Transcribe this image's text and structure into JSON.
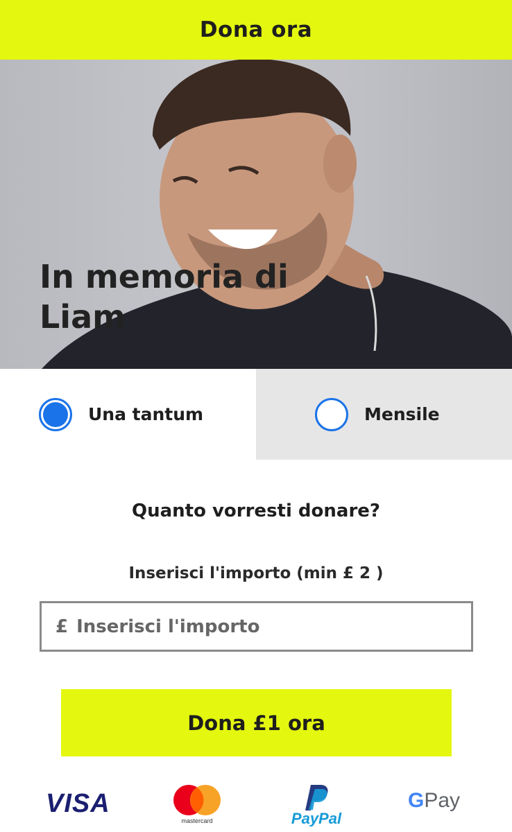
{
  "header": {
    "title": "Dona ora"
  },
  "hero": {
    "title": "In memoria di Liam"
  },
  "frequency": {
    "options": [
      {
        "label": "Una tantum",
        "selected": true
      },
      {
        "label": "Mensile",
        "selected": false
      }
    ]
  },
  "form": {
    "question": "Quanto vorresti donare?",
    "amount_label": "Inserisci l'importo (min £ 2 )",
    "currency_symbol": "£",
    "amount_placeholder": "Inserisci l'importo",
    "amount_value": ""
  },
  "donate_button": {
    "label": "Dona £1 ora"
  },
  "payment_methods": {
    "visa": "VISA",
    "mastercard": "mastercard",
    "paypal": "PayPal",
    "gpay_g": "G",
    "gpay_text": "Pay"
  },
  "colors": {
    "accent": "#e4f70f",
    "radio": "#1a73e8",
    "unselected_tab": "#e6e6e6"
  }
}
